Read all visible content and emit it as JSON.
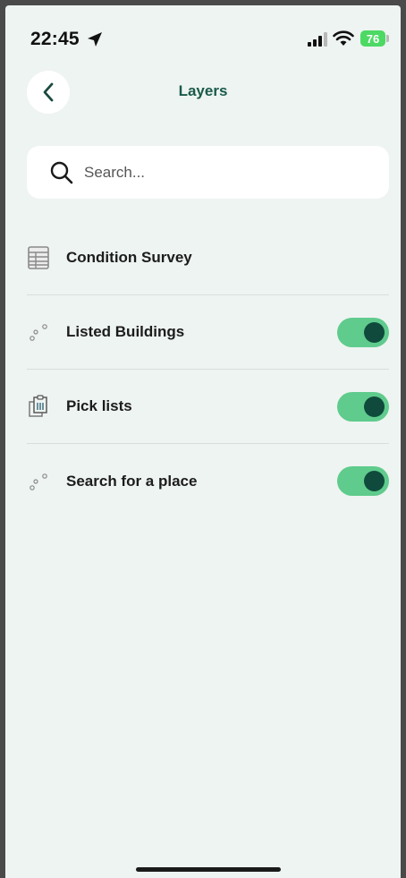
{
  "status_bar": {
    "time": "22:45",
    "battery": "76",
    "icons": [
      "location-arrow-icon",
      "cellular-signal-icon",
      "wifi-icon",
      "battery-charging-icon"
    ]
  },
  "header": {
    "title": "Layers",
    "back_icon": "chevron-left-icon"
  },
  "search": {
    "placeholder": "Search...",
    "value": "",
    "icon": "search-icon"
  },
  "layers": [
    {
      "label": "Condition Survey",
      "icon": "table-icon",
      "has_toggle": false
    },
    {
      "label": "Listed Buildings",
      "icon": "points-icon",
      "has_toggle": true,
      "enabled": true
    },
    {
      "label": "Pick lists",
      "icon": "clipboard-list-icon",
      "has_toggle": true,
      "enabled": true
    },
    {
      "label": "Search for a place",
      "icon": "points-icon",
      "has_toggle": true,
      "enabled": true
    }
  ],
  "colors": {
    "background": "#eef4f1",
    "accent_dark": "#0f4a3c",
    "toggle_on": "#5fcb8c",
    "title": "#1a5a4a"
  }
}
